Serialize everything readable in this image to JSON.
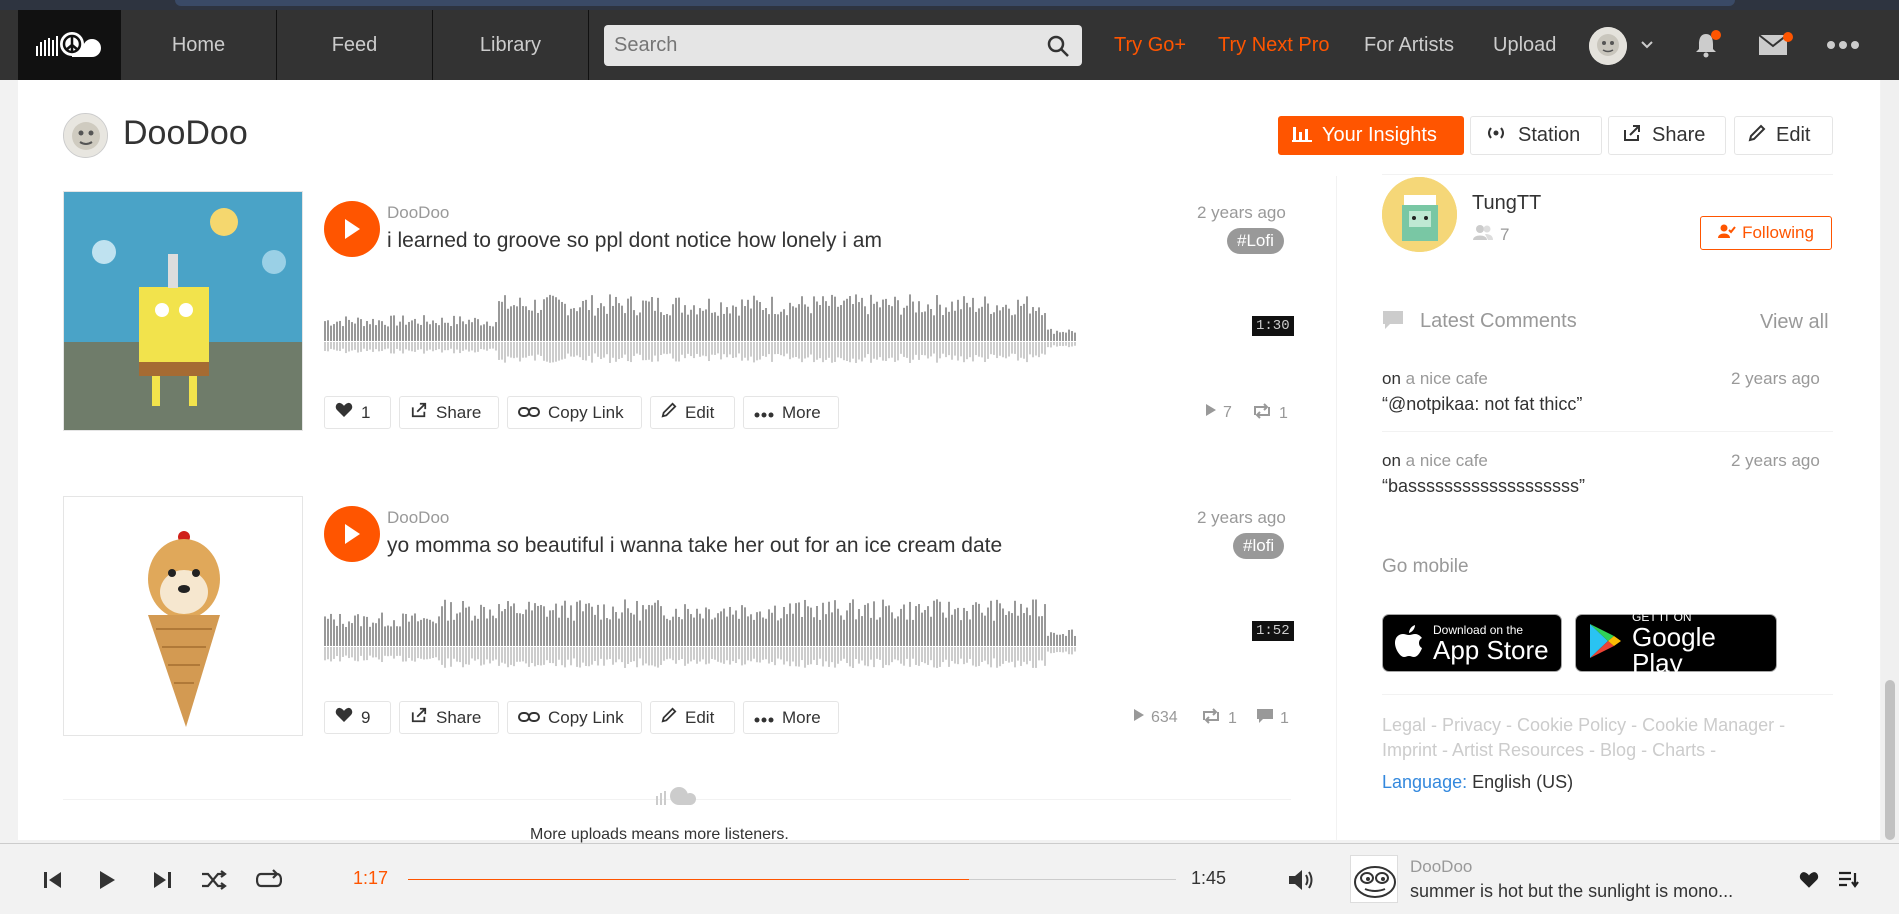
{
  "header": {
    "nav": [
      "Home",
      "Feed",
      "Library"
    ],
    "search_placeholder": "Search",
    "try_go": "Try Go+",
    "try_next_pro": "Try Next Pro",
    "for_artists": "For Artists",
    "upload": "Upload"
  },
  "profile": {
    "name": "DooDoo",
    "insights": "Your Insights",
    "station": "Station",
    "share": "Share",
    "edit": "Edit"
  },
  "tracks": [
    {
      "user": "DooDoo",
      "title": "i learned to groove so ppl dont notice how lonely i am",
      "posted": "2 years ago",
      "tag": "Lofi",
      "duration": "1:30",
      "likes": "1",
      "plays": "7",
      "reposts": "1",
      "comments": ""
    },
    {
      "user": "DooDoo",
      "title": "yo momma so beautiful i wanna take her out for an ice cream date",
      "posted": "2 years ago",
      "tag": "lofi",
      "duration": "1:52",
      "likes": "9",
      "plays": "634",
      "reposts": "1",
      "comments": "1"
    }
  ],
  "actions": {
    "share": "Share",
    "copy_link": "Copy Link",
    "edit": "Edit",
    "more": "More"
  },
  "uploads_note": "More uploads means more listeners.",
  "sidebar": {
    "following_user": "TungTT",
    "following_count": "7",
    "following_label": "Following",
    "latest_comments": "Latest Comments",
    "view_all": "View all",
    "comments": [
      {
        "on": "on",
        "track": "a nice cafe",
        "time": "2 years ago",
        "text": "“@notpikaa: not fat thicc”"
      },
      {
        "on": "on",
        "track": "a nice cafe",
        "time": "2 years ago",
        "text": "“basssssssssssssssssss”"
      }
    ],
    "go_mobile": "Go mobile",
    "app_store": {
      "small": "Download on the",
      "big": "App Store"
    },
    "google_play": {
      "small": "GET IT ON",
      "big": "Google Play"
    },
    "legal_line1": "Legal - Privacy - Cookie Policy - Cookie Manager -",
    "legal_line2": "Imprint - Artist Resources - Blog - Charts -",
    "language_label": "Language:",
    "language_value": "English (US)"
  },
  "player": {
    "elapsed": "1:17",
    "total": "1:45",
    "progress": 0.73,
    "user": "DooDoo",
    "title": "summer is hot but the sunlight is mono...",
    "accent": "#ff5500"
  }
}
